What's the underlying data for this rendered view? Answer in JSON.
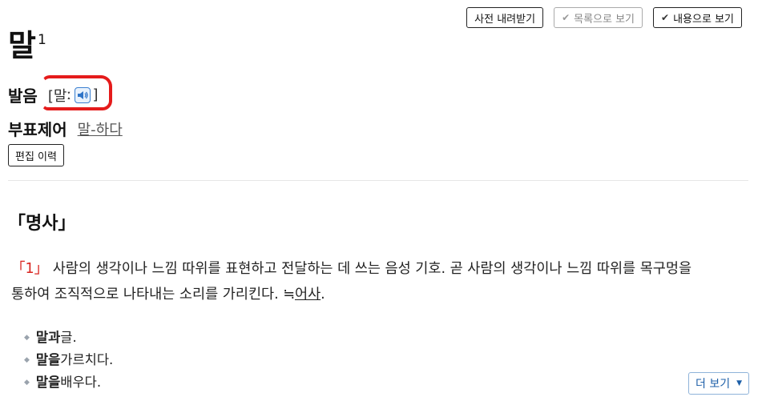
{
  "toolbar": {
    "download_label": "사전 내려받기",
    "list_view_label": "목록으로 보기",
    "content_view_label": "내용으로 보기"
  },
  "entry": {
    "headword": "말",
    "sense_number": "1",
    "pronunciation_label": "발음",
    "pronunciation_open": "[말",
    "pronunciation_long_mark": "ː",
    "pronunciation_close": "]",
    "subentry_label": "부표제어",
    "subentry_link": "말-하다",
    "edit_history_label": "편집 이력"
  },
  "definition": {
    "part_of_speech": "「명사」",
    "number_open": "「",
    "number": "1",
    "number_close": "」",
    "text_before": " 사람의 생각이나 느낌 따위를 표현하고 전달하는 데 쓰는 음성 기호. 곧 사람의 생각이나 느낌 따위를 목구멍을 통하여 조직적으로 나타내는 소리를 가리킨다. ≒",
    "synonym_link": "어사",
    "text_after": ".",
    "examples": [
      {
        "bold": "말과",
        "rest": " 글."
      },
      {
        "bold": "말을",
        "rest": " 가르치다."
      },
      {
        "bold": "말을",
        "rest": " 배우다."
      }
    ],
    "more_label": "더 보기"
  },
  "colors": {
    "accent_red": "#d9241f",
    "annotation_red": "#e51b1b",
    "link_blue": "#1d5fa8"
  },
  "icons": {
    "check": "check-icon",
    "speaker": "speaker-icon",
    "caret": "caret-down-icon"
  }
}
